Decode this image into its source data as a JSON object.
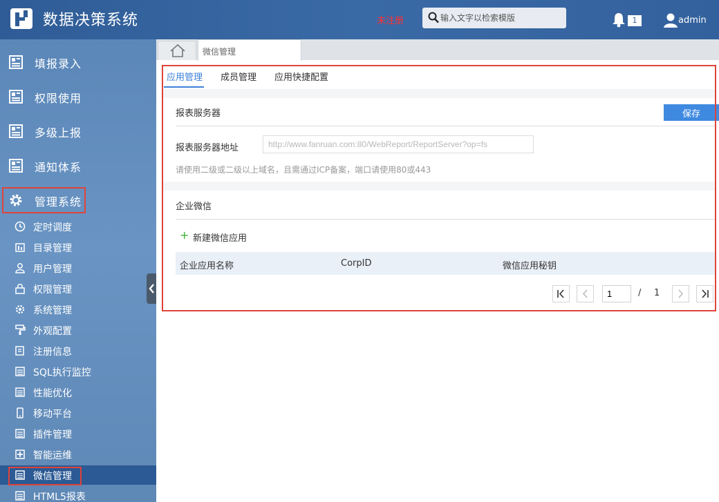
{
  "header": {
    "app_title": "数据决策系统",
    "unregistered": "未注册",
    "search_placeholder": "输入文字以检索模版",
    "notification_count": "1",
    "username": "admin"
  },
  "sidebar": {
    "main_items": [
      {
        "label": "填报录入",
        "icon": "report-icon"
      },
      {
        "label": "权限使用",
        "icon": "report-icon"
      },
      {
        "label": "多级上报",
        "icon": "report-icon"
      },
      {
        "label": "通知体系",
        "icon": "report-icon"
      },
      {
        "label": "管理系统",
        "icon": "gear-icon"
      }
    ],
    "sub_items": [
      {
        "label": "定时调度",
        "icon": "clock-icon"
      },
      {
        "label": "目录管理",
        "icon": "folder-icon"
      },
      {
        "label": "用户管理",
        "icon": "user-icon"
      },
      {
        "label": "权限管理",
        "icon": "lock-icon"
      },
      {
        "label": "系统管理",
        "icon": "gear-icon"
      },
      {
        "label": "外观配置",
        "icon": "brush-icon"
      },
      {
        "label": "注册信息",
        "icon": "register-icon"
      },
      {
        "label": "SQL执行监控",
        "icon": "table-icon"
      },
      {
        "label": "性能优化",
        "icon": "table-icon"
      },
      {
        "label": "移动平台",
        "icon": "mobile-icon"
      },
      {
        "label": "插件管理",
        "icon": "table-icon"
      },
      {
        "label": "智能运维",
        "icon": "plus-box-icon"
      },
      {
        "label": "微信管理",
        "icon": "table-icon"
      },
      {
        "label": "HTML5报表",
        "icon": "table-icon"
      }
    ],
    "active_sub": "微信管理"
  },
  "tabs": {
    "page_tab": "微信管理"
  },
  "subtabs": [
    "应用管理",
    "成员管理",
    "应用快捷配置"
  ],
  "report_server": {
    "section_title": "报表服务器",
    "save_label": "保存",
    "field_label": "报表服务器地址",
    "url_placeholder": "http://www.fanruan.com:80/WebReport/ReportServer?op=fs",
    "hint": "请使用二级或二级以上域名，且需通过ICP备案，端口请使用80或443"
  },
  "wechat": {
    "section_title": "企业微信",
    "new_app_label": "新建微信应用",
    "columns": [
      "企业应用名称",
      "CorpID",
      "微信应用秘钥"
    ]
  },
  "pager": {
    "current_page": "1",
    "separator": "/",
    "total_pages": "1"
  },
  "colors": {
    "header_bg": "#2f5c96",
    "accent": "#3c80d9",
    "highlight_border": "#e0433a",
    "warning": "#ff3030"
  }
}
